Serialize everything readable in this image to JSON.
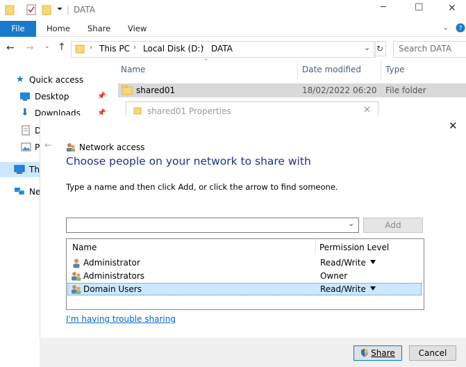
{
  "window": {
    "title": "DATA",
    "minimize": "─",
    "maximize": "☐",
    "close": "✕"
  },
  "ribbon": {
    "tabs": [
      "File",
      "Home",
      "Share",
      "View"
    ]
  },
  "address": {
    "path": [
      "This PC",
      "Local Disk (D:)",
      "DATA"
    ],
    "search_placeholder": "Search DATA"
  },
  "navpane": {
    "items": [
      {
        "label": "Quick access",
        "icon": "star-icon"
      },
      {
        "label": "Desktop",
        "icon": "desktop-icon"
      },
      {
        "label": "Downloads",
        "icon": "download-icon"
      },
      {
        "label": "D",
        "icon": "document-icon"
      },
      {
        "label": "P",
        "icon": "pictures-icon"
      },
      {
        "label": "Th",
        "icon": "this-pc-icon"
      },
      {
        "label": "Ne",
        "icon": "network-icon"
      }
    ]
  },
  "filelist": {
    "columns": [
      "Name",
      "Date modified",
      "Type"
    ],
    "rows": [
      {
        "name": "shared01",
        "date": "18/02/2022 06:20",
        "type": "File folder"
      }
    ]
  },
  "properties_window": {
    "title": "shared01 Properties"
  },
  "dialog": {
    "header": "Network access",
    "heading": "Choose people on your network to share with",
    "instruction": "Type a name and then click Add, or click the arrow to find someone.",
    "name_input_value": "",
    "add_button": "Add",
    "table": {
      "columns": [
        "Name",
        "Permission Level"
      ],
      "rows": [
        {
          "name": "Administrator",
          "permission": "Read/Write",
          "has_dropdown": true,
          "selected": false
        },
        {
          "name": "Administrators",
          "permission": "Owner",
          "has_dropdown": false,
          "selected": false
        },
        {
          "name": "Domain Users",
          "permission": "Read/Write",
          "has_dropdown": true,
          "selected": true
        }
      ]
    },
    "trouble_link": "I'm having trouble sharing",
    "share_button": "Share",
    "cancel_button": "Cancel",
    "close": "✕",
    "back": "←"
  },
  "colors": {
    "accent": "#1979ca",
    "heading": "#1e3287",
    "selection": "#cce8ff",
    "link": "#0066cc"
  }
}
